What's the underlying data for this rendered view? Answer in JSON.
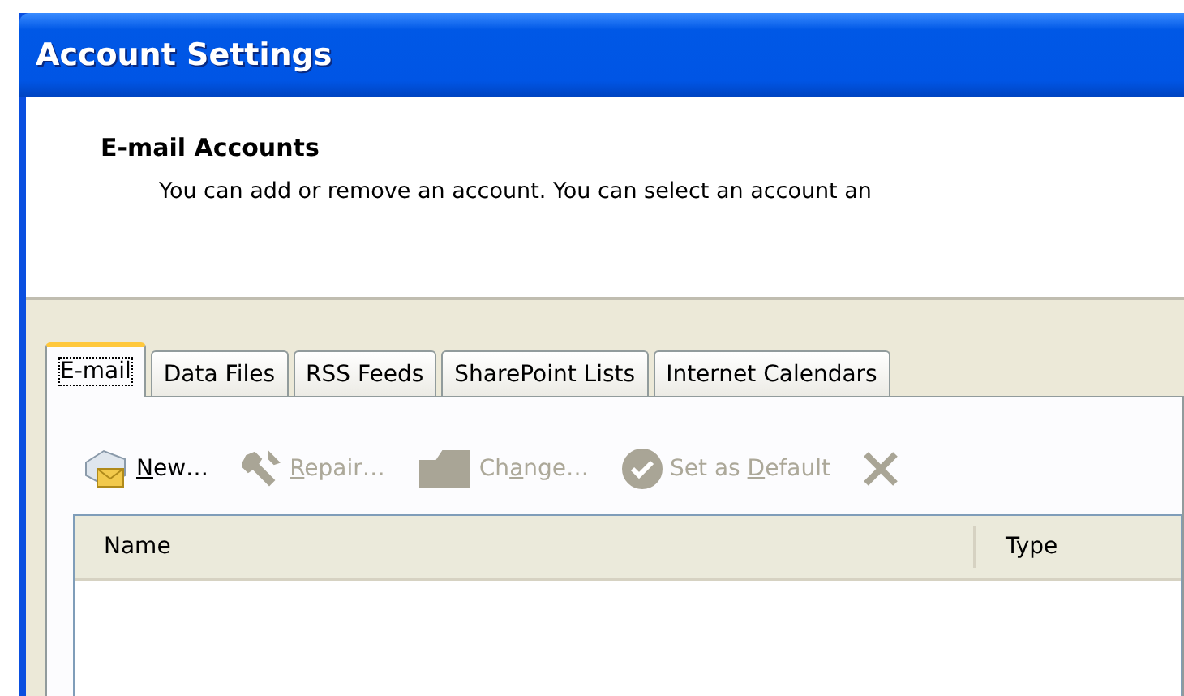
{
  "window": {
    "title": "Account Settings"
  },
  "header": {
    "title": "E-mail Accounts",
    "description": "You can add or remove an account. You can select an account an"
  },
  "tabs": [
    {
      "label": "E-mail",
      "selected": true
    },
    {
      "label": "Data Files",
      "selected": false
    },
    {
      "label": "RSS Feeds",
      "selected": false
    },
    {
      "label": "SharePoint Lists",
      "selected": false
    },
    {
      "label": "Internet Calendars",
      "selected": false
    }
  ],
  "toolbar": [
    {
      "kind": "new",
      "label": {
        "key": "N",
        "post": "ew…"
      },
      "disabled": false
    },
    {
      "kind": "repair",
      "label": {
        "key": "R",
        "post": "epair…"
      },
      "disabled": true
    },
    {
      "kind": "change",
      "label": {
        "pre": "Ch",
        "key": "a",
        "post": "nge…"
      },
      "disabled": true
    },
    {
      "kind": "default",
      "label": {
        "pre": "Set as ",
        "key": "D",
        "post": "efault"
      },
      "disabled": true
    },
    {
      "kind": "remove",
      "disabled": true
    }
  ],
  "table": {
    "columns": [
      "Name",
      "Type"
    ]
  }
}
